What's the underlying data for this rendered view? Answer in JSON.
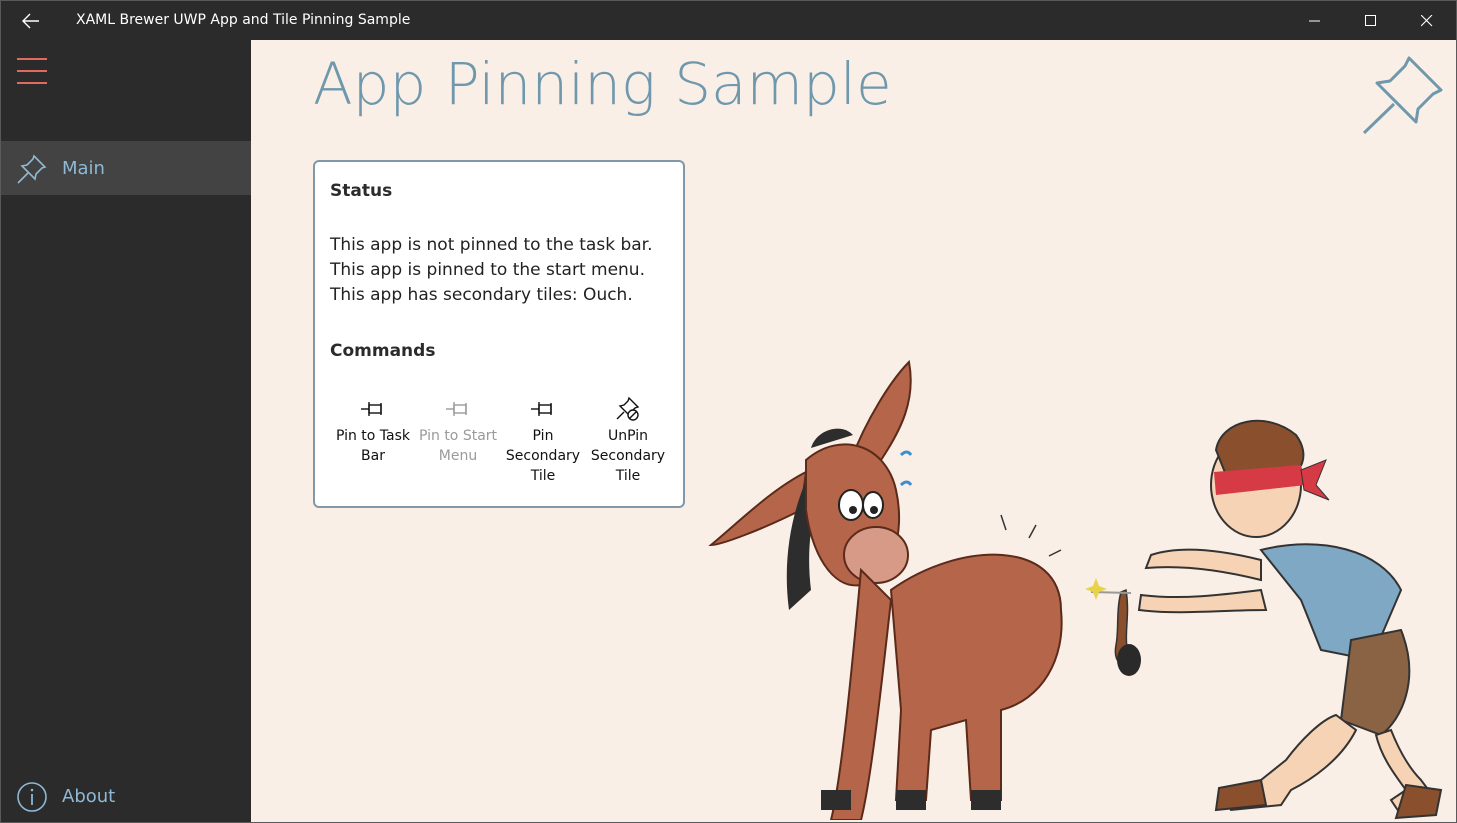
{
  "titlebar": {
    "title": "XAML Brewer UWP App and Tile Pinning Sample",
    "back_icon": "back-arrow-icon",
    "minimize_icon": "minimize-icon",
    "maximize_icon": "maximize-icon",
    "close_icon": "close-icon"
  },
  "sidebar": {
    "menu_icon": "hamburger-icon",
    "items": [
      {
        "label": "Main",
        "icon": "pin-icon",
        "selected": true
      }
    ],
    "footer": {
      "label": "About",
      "icon": "info-icon"
    }
  },
  "main": {
    "page_title": "App Pinning Sample",
    "card": {
      "status_heading": "Status",
      "status_lines": [
        "This app is not pinned to the task bar.",
        "This app is pinned to the start menu.",
        "This app has secondary tiles: Ouch."
      ],
      "commands_heading": "Commands",
      "commands": [
        {
          "line1": "Pin to Task",
          "line2": "Bar",
          "line3": "",
          "enabled": true,
          "icon": "pin-icon"
        },
        {
          "line1": "Pin to Start",
          "line2": "Menu",
          "line3": "",
          "enabled": false,
          "icon": "pin-icon"
        },
        {
          "line1": "Pin",
          "line2": "Secondary",
          "line3": "Tile",
          "enabled": true,
          "icon": "pin-icon"
        },
        {
          "line1": "UnPin",
          "line2": "Secondary",
          "line3": "Tile",
          "enabled": true,
          "icon": "unpin-icon"
        }
      ]
    }
  },
  "colors": {
    "accent_title": "#6f98ad",
    "sidebar_bg": "#2b2b2b",
    "page_bg": "#faefe6",
    "hamburger": "#e06a5f",
    "nav_label": "#8fb9d4"
  }
}
